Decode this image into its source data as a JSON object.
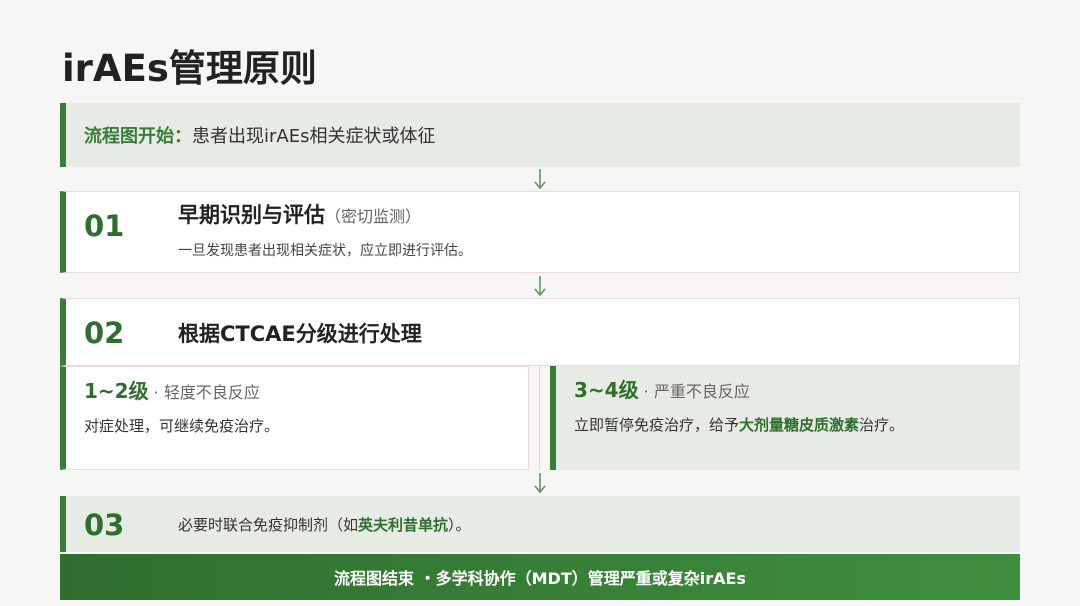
{
  "title": "irAEs管理原则",
  "start": {
    "label": "流程图开始：",
    "text": "患者出现irAEs相关症状或体征"
  },
  "step1": {
    "num": "01",
    "title": "早期识别与评估",
    "sub": "（密切监测）",
    "desc": "一旦发现患者出现相关症状，应立即进行评估。"
  },
  "step2": {
    "num": "02",
    "title": "根据CTCAE分级进行处理"
  },
  "grade1": {
    "head": "1~2级",
    "sub": " · 轻度不良反应",
    "desc": "对症处理，可继续免疫治疗。"
  },
  "grade2": {
    "head": "3~4级",
    "sub": " · 严重不良反应",
    "desc_pre": "立即暂停免疫治疗，给予",
    "desc_hl": "大剂量糖皮质激素",
    "desc_post": "治疗。"
  },
  "step3": {
    "num": "03",
    "desc_pre": "必要时联合免疫抑制剂（如",
    "desc_hl": "英夫利昔单抗",
    "desc_post": "）。"
  },
  "end": {
    "text": "流程图结束 ・多学科协作（MDT）管理严重或复杂irAEs"
  },
  "colors": {
    "accent": "#3a7d3a",
    "panel": "#e6ece4"
  }
}
